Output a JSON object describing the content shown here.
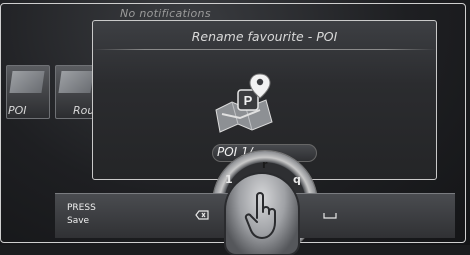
{
  "notification": "No notifications",
  "background_tiles": [
    {
      "label": "POI"
    },
    {
      "label": "Rou"
    }
  ],
  "dialog": {
    "title": "Rename favourite - POI",
    "input_value": "POI 1/"
  },
  "speller": {
    "chars": [
      "1",
      "r",
      "q"
    ]
  },
  "bottom_bar": {
    "press": "PRESS",
    "save": "Save"
  },
  "icons": {
    "delete": "backspace-icon",
    "space": "space-icon",
    "controller": "touch-hand-icon",
    "map": "map-pin-icon",
    "parking": "P"
  }
}
